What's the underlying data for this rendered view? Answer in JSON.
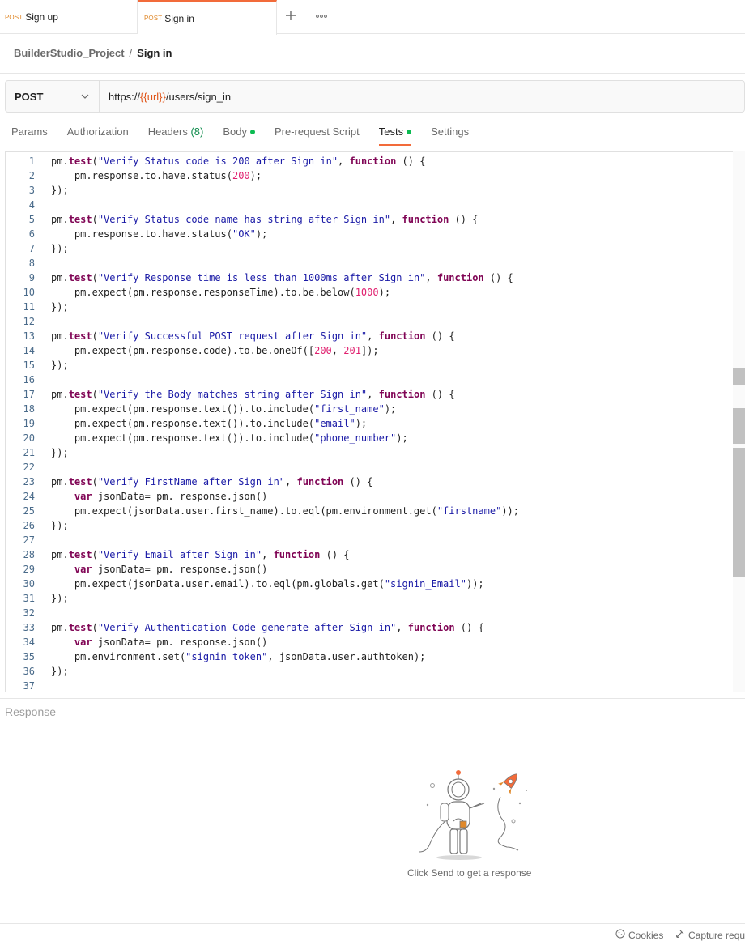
{
  "tabs": [
    {
      "method": "POST",
      "name": "Sign up"
    },
    {
      "method": "POST",
      "name": "Sign in"
    }
  ],
  "tabbar": {
    "add_icon": "plus-icon",
    "more_icon": "ellipsis-icon"
  },
  "breadcrumb": {
    "project": "BuilderStudio_Project",
    "separator": "/",
    "current": "Sign in"
  },
  "request": {
    "method": "POST",
    "url_prefix": "https://",
    "url_variable": "{{url}}",
    "url_path": "/users/sign_in"
  },
  "request_tabs": [
    {
      "label": "Params"
    },
    {
      "label": "Authorization"
    },
    {
      "label": "Headers",
      "count": "(8)"
    },
    {
      "label": "Body",
      "dot": true
    },
    {
      "label": "Pre-request Script"
    },
    {
      "label": "Tests",
      "dot": true,
      "active": true
    },
    {
      "label": "Settings"
    }
  ],
  "code_lines": [
    "pm.test(\"Verify Status code is 200 after Sign in\", function () {",
    "    pm.response.to.have.status(200);",
    "});",
    "",
    "pm.test(\"Verify Status code name has string after Sign in\", function () {",
    "    pm.response.to.have.status(\"OK\");",
    "});",
    "",
    "pm.test(\"Verify Response time is less than 1000ms after Sign in\", function () {",
    "    pm.expect(pm.response.responseTime).to.be.below(1000);",
    "});",
    "",
    "pm.test(\"Verify Successful POST request after Sign in\", function () {",
    "    pm.expect(pm.response.code).to.be.oneOf([200, 201]);",
    "});",
    "",
    "pm.test(\"Verify the Body matches string after Sign in\", function () {",
    "    pm.expect(pm.response.text()).to.include(\"first_name\");",
    "    pm.expect(pm.response.text()).to.include(\"email\");",
    "    pm.expect(pm.response.text()).to.include(\"phone_number\");",
    "});",
    "",
    "pm.test(\"Verify FirstName after Sign in\", function () {",
    "    var jsonData= pm. response.json()",
    "    pm.expect(jsonData.user.first_name).to.eql(pm.environment.get(\"firstname\"));",
    "});",
    "",
    "pm.test(\"Verify Email after Sign in\", function () {",
    "    var jsonData= pm. response.json()",
    "    pm.expect(jsonData.user.email).to.eql(pm.globals.get(\"signin_Email\"));",
    "});",
    "",
    "pm.test(\"Verify Authentication Code generate after Sign in\", function () {",
    "    var jsonData= pm. response.json()",
    "    pm.environment.set(\"signin_token\", jsonData.user.authtoken);",
    "});",
    ""
  ],
  "response": {
    "label": "Response",
    "illustration_icon": "astronaut-rocket-illustration",
    "hint": "Click Send to get a response"
  },
  "footer": {
    "cookies_label": "Cookies",
    "cookies_icon": "cookie-icon",
    "capture_label": "Capture requ",
    "capture_icon": "capture-icon"
  },
  "colors": {
    "accent": "#f26b3a",
    "method_post": "#e0892b",
    "status_dot": "#0cbb52",
    "keyword": "#800555",
    "string": "#1a1aa6",
    "number": "#e01f6e"
  }
}
